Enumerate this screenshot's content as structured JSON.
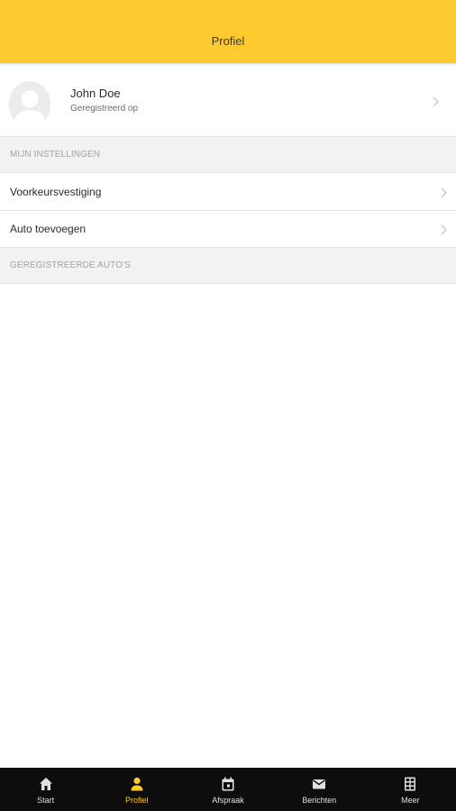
{
  "header": {
    "title": "Profiel"
  },
  "profile": {
    "name": "John Doe",
    "subtitle": "Geregistreerd op"
  },
  "settings": {
    "section_title": "MIJN INSTELLINGEN",
    "items": [
      {
        "label": "Voorkeursvestiging"
      },
      {
        "label": "Auto toevoegen"
      }
    ]
  },
  "cars": {
    "section_title": "GEREGISTREERDE AUTO'S"
  },
  "tabbar": {
    "tabs": [
      {
        "label": "Start",
        "icon": "home-icon"
      },
      {
        "label": "Profiel",
        "icon": "person-icon"
      },
      {
        "label": "Afspraak",
        "icon": "calendar-icon"
      },
      {
        "label": "Berichten",
        "icon": "mail-icon"
      },
      {
        "label": "Meer",
        "icon": "grid-icon"
      }
    ],
    "active_index": 1
  },
  "colors": {
    "brand": "#fdca30",
    "tabbar_bg": "#0d0d0d",
    "section_bg": "#f2f2f2"
  }
}
